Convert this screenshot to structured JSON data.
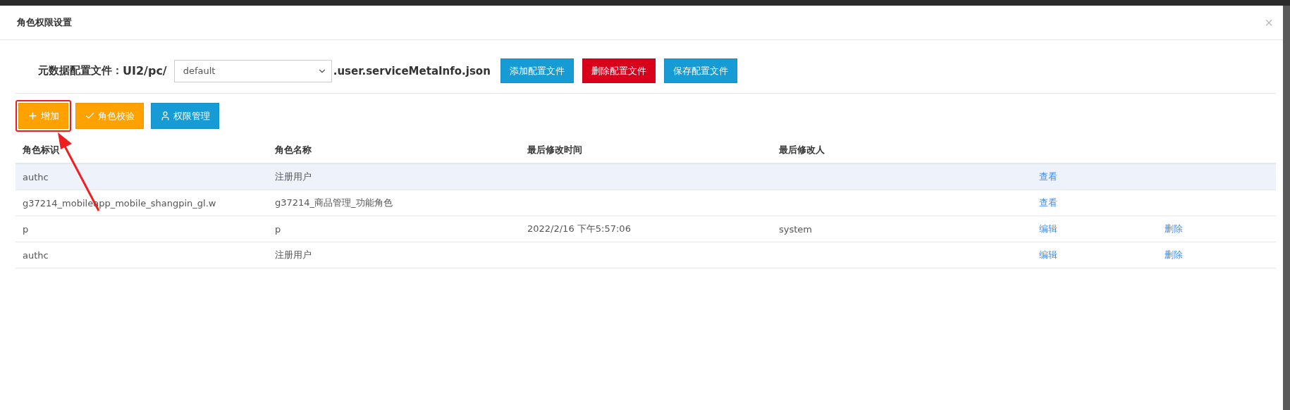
{
  "dialog": {
    "title": "角色权限设置",
    "close": "×"
  },
  "config": {
    "label": "元数据配置文件：",
    "prefix": "UI2/pc/",
    "select_value": "default",
    "suffix": ".user.serviceMetaInfo.json",
    "buttons": [
      {
        "label": "添加配置文件",
        "kind": "info"
      },
      {
        "label": "删除配置文件",
        "kind": "danger"
      },
      {
        "label": "保存配置文件",
        "kind": "info"
      }
    ]
  },
  "toolbar": [
    {
      "label": "增加",
      "kind": "warning",
      "highlighted": true
    },
    {
      "label": "角色校验",
      "kind": "warning",
      "highlighted": false
    },
    {
      "label": "权限管理",
      "kind": "info",
      "highlighted": false
    }
  ],
  "table": {
    "columns": [
      "角色标识",
      "角色名称",
      "最后修改时间",
      "最后修改人"
    ],
    "rows": [
      {
        "selected": true,
        "cells": [
          "authc",
          "注册用户",
          "",
          ""
        ],
        "actions": [
          "查看"
        ]
      },
      {
        "selected": false,
        "cells": [
          "g37214_mobileapp_mobile_shangpin_gl.w",
          "g37214_商品管理_功能角色",
          "",
          ""
        ],
        "actions": [
          "查看"
        ]
      },
      {
        "selected": false,
        "cells": [
          "p",
          "p",
          "2022/2/16 下午5:57:06",
          "system"
        ],
        "actions": [
          "编辑",
          "删除"
        ]
      },
      {
        "selected": false,
        "cells": [
          "authc",
          "注册用户",
          "",
          ""
        ],
        "actions": [
          "编辑",
          "删除"
        ]
      }
    ]
  }
}
